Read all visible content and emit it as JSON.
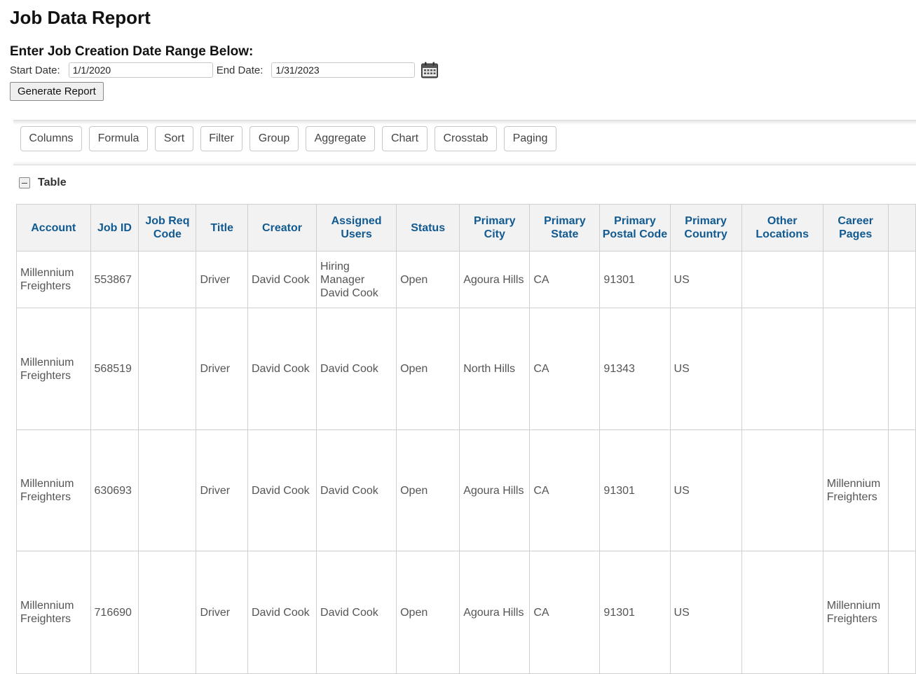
{
  "page": {
    "title": "Job Data Report"
  },
  "date_range": {
    "heading": "Enter Job Creation Date Range Below:",
    "start_label": "Start Date:",
    "start_value": "1/1/2020",
    "end_label": "End Date:",
    "end_value": "1/31/2023",
    "calendar_icon": "calendar-icon"
  },
  "generate_label": "Generate Report",
  "toolbar": {
    "columns": "Columns",
    "formula": "Formula",
    "sort": "Sort",
    "filter": "Filter",
    "group": "Group",
    "aggregate": "Aggregate",
    "chart": "Chart",
    "crosstab": "Crosstab",
    "paging": "Paging"
  },
  "table": {
    "caption": "Table",
    "columns": [
      "Account",
      "Job ID",
      "Job Req Code",
      "Title",
      "Creator",
      "Assigned Users",
      "Status",
      "Primary City",
      "Primary State",
      "Primary Postal Code",
      "Primary Country",
      "Other Locations",
      "Career Pages"
    ],
    "rows": [
      [
        "Millennium Freighters",
        "553867",
        "",
        "Driver",
        "David Cook",
        "Hiring Manager David Cook",
        "Open",
        "Agoura Hills",
        "CA",
        "91301",
        "US",
        "",
        ""
      ],
      [
        "Millennium Freighters",
        "568519",
        "",
        "Driver",
        "David Cook",
        "David Cook",
        "Open",
        "North Hills",
        "CA",
        "91343",
        "US",
        "",
        ""
      ],
      [
        "Millennium Freighters",
        "630693",
        "",
        "Driver",
        "David Cook",
        "David Cook",
        "Open",
        "Agoura Hills",
        "CA",
        "91301",
        "US",
        "",
        "Millennium Freighters"
      ],
      [
        "Millennium Freighters",
        "716690",
        "",
        "Driver",
        "David Cook",
        "David Cook",
        "Open",
        "Agoura Hills",
        "CA",
        "91301",
        "US",
        "",
        "Millennium Freighters"
      ]
    ]
  }
}
